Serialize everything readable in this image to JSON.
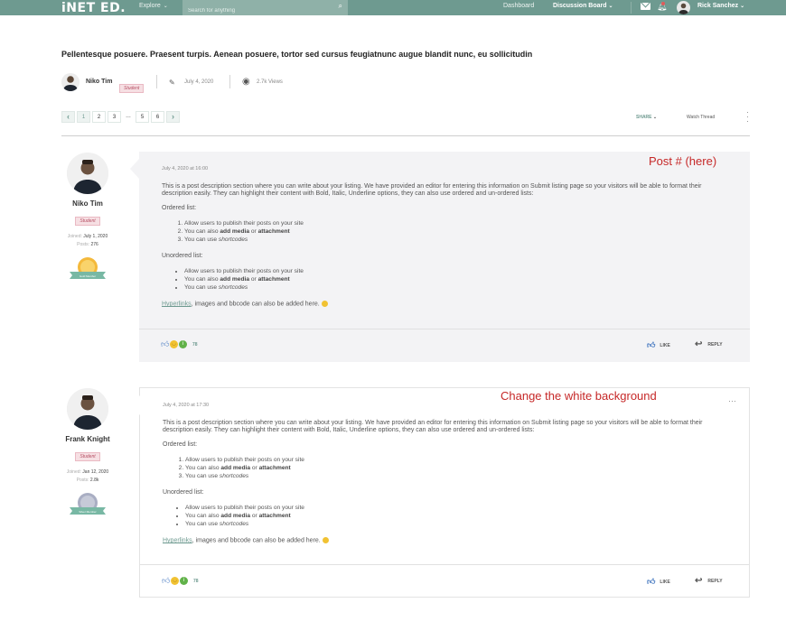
{
  "nav": {
    "logo": "iNET ED.",
    "explore": "Explore",
    "search_placeholder": "Search for anything",
    "dashboard": "Dashboard",
    "discussion_board": "Discussion Board",
    "user_name": "Rick Sanchez"
  },
  "thread": {
    "title": "Pellentesque posuere. Praesent turpis. Aenean posuere, tortor sed cursus feugiatnunc augue blandit nunc, eu sollicitudin",
    "author": "Niko Tim",
    "author_badge": "Student",
    "date": "July 4, 2020",
    "views": "2.7k Views"
  },
  "pagination": {
    "prev": "‹",
    "pages": [
      "1",
      "2",
      "3",
      "…",
      "5",
      "6"
    ],
    "active": "1",
    "next": "›"
  },
  "toolbar": {
    "share": "SHARE",
    "watch": "Watch Thread"
  },
  "posts": [
    {
      "user": "Niko Tim",
      "badge": "Student",
      "joined_label": "Joined:",
      "joined": "July 1, 2020",
      "posts_label": "Posts:",
      "posts": "276",
      "medal_label": "Gold Member",
      "date": "July 4, 2020 at 16:00",
      "intro": "This is a post description section where you can write about your listing. We have provided an editor for entering this information on Submit listing page so your visitors will be able to format their description easily. They can highlight their content with Bold, Italic, Underline options, they can also use ordered and un-ordered lists:",
      "ordered_heading": "Ordered list:",
      "ordered": [
        "Allow users to publish their posts on your site",
        "You can also",
        "You can use"
      ],
      "unordered_heading": "Unordered list:",
      "unordered": [
        "Allow users to publish their posts on your site",
        "You can also",
        "You can use"
      ],
      "bold_a": "add media",
      "or": "or",
      "bold_b": "attachment",
      "italic": "shortcodes",
      "link": "Hyperlinks",
      "closing": ", images and bbcode can also be added here.",
      "reaction_count": "78",
      "like": "LIKE",
      "reply": "REPLY",
      "annotation": "Post # (here)"
    },
    {
      "user": "Frank Knight",
      "badge": "Student",
      "joined_label": "Joined:",
      "joined": "Jan 12, 2020",
      "posts_label": "Posts:",
      "posts": "2.8k",
      "medal_label": "Silver Member",
      "date": "July 4, 2020 at 17:30",
      "intro": "This is a post description section where you can write about your listing. We have provided an editor for entering this information on Submit listing page so your visitors will be able to format their description easily. They can highlight their content with Bold, Italic, Underline options, they can also use ordered and un-ordered lists:",
      "ordered_heading": "Ordered list:",
      "ordered": [
        "Allow users to publish their posts on your site",
        "You can also",
        "You can use"
      ],
      "unordered_heading": "Unordered list:",
      "unordered": [
        "Allow users to publish their posts on your site",
        "You can also",
        "You can use"
      ],
      "bold_a": "add media",
      "or": "or",
      "bold_b": "attachment",
      "italic": "shortcodes",
      "link": "Hyperlinks",
      "closing": ", images and bbcode can also be added here.",
      "reaction_count": "78",
      "like": "LIKE",
      "reply": "REPLY",
      "annotation": "Change the white background",
      "more": "···"
    }
  ],
  "colors": {
    "brand": "#6e9a90",
    "annotation": "#c62828",
    "badge_bg": "#f6dfe3"
  }
}
